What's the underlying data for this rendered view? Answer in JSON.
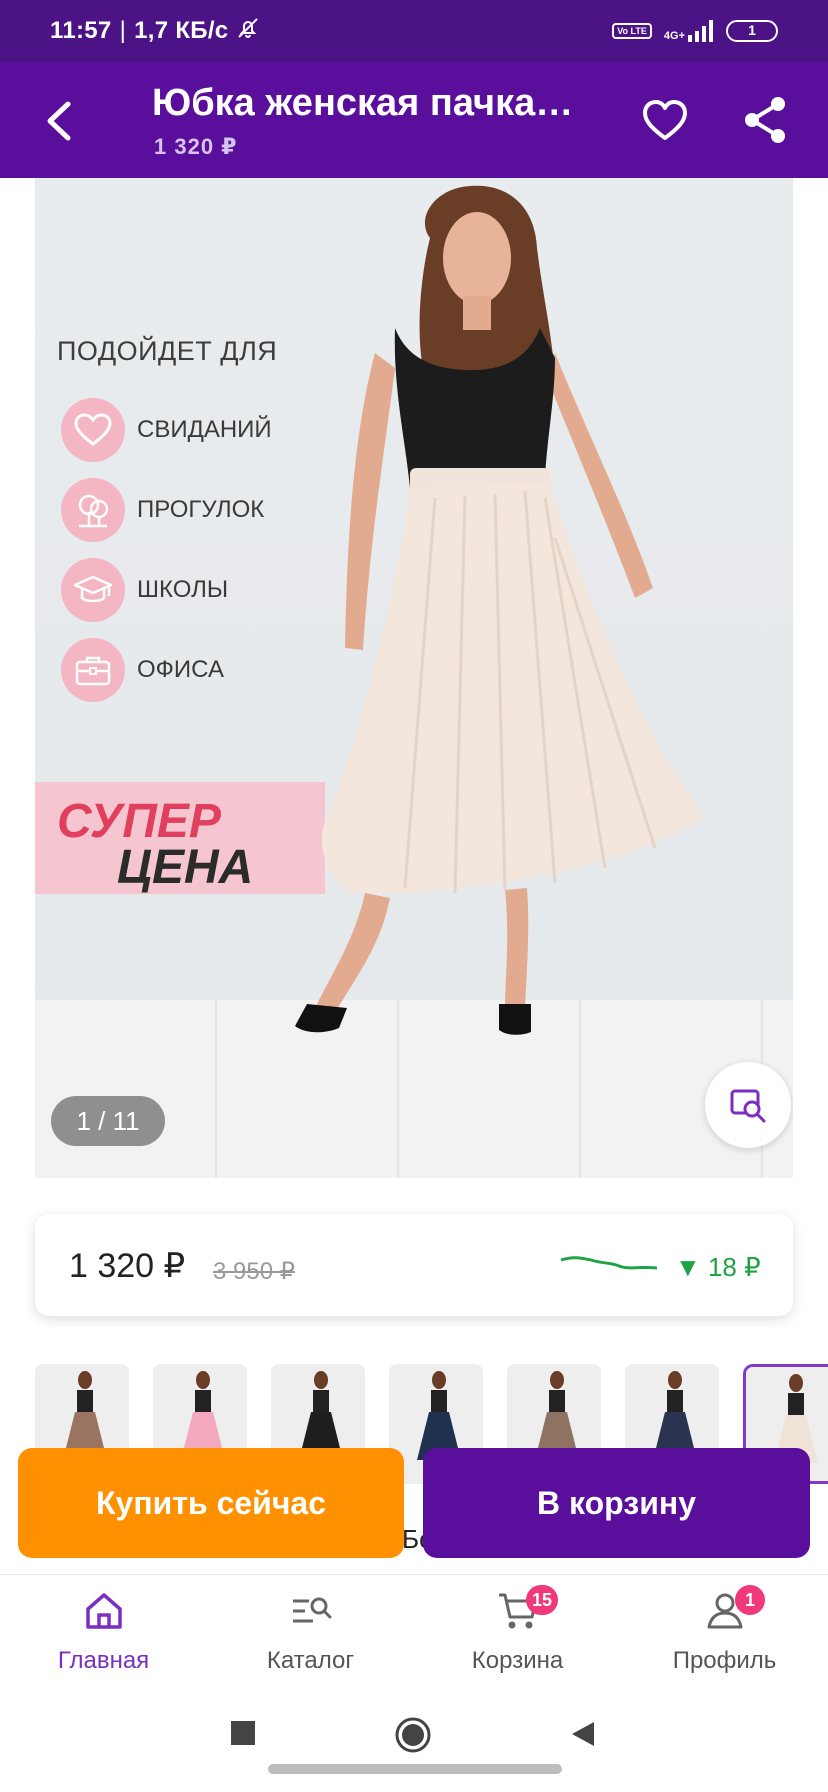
{
  "status_bar": {
    "time": "11:57",
    "separator": "|",
    "speed": "1,7 КБ/с",
    "volte": "Vo LTE",
    "network": "4G+",
    "battery": "1"
  },
  "header": {
    "title": "Юбка женская пачка…",
    "price": "1 320 ₽"
  },
  "product_image": {
    "suitable_title": "ПОДОЙДЕТ ДЛЯ",
    "suitable_items": [
      {
        "label": "СВИДАНИЙ",
        "icon": "heart-icon"
      },
      {
        "label": "ПРОГУЛОК",
        "icon": "tree-icon"
      },
      {
        "label": "ШКОЛЫ",
        "icon": "graduation-cap-icon"
      },
      {
        "label": "ОФИСА",
        "icon": "briefcase-icon"
      }
    ],
    "promo_line1": "СУПЕР",
    "promo_line2": "ЦЕНА",
    "counter": "1 / 11"
  },
  "price_card": {
    "current": "1 320 ₽",
    "old": "3 950 ₽",
    "delta": "▼ 18 ₽"
  },
  "thumbnails": [
    {
      "skirt_color": "#9b7461",
      "selected": false
    },
    {
      "skirt_color": "#f3a8bd",
      "selected": false
    },
    {
      "skirt_color": "#1e1e1e",
      "selected": false
    },
    {
      "skirt_color": "#20304f",
      "selected": false
    },
    {
      "skirt_color": "#8e7262",
      "selected": false
    },
    {
      "skirt_color": "#2a3350",
      "selected": false
    },
    {
      "skirt_color": "#efe3d8",
      "selected": true
    }
  ],
  "actions": {
    "buy_now": "Купить сейчас",
    "add_to_cart": "В корзину",
    "peek": "Бе"
  },
  "bottom_nav": [
    {
      "label": "Главная",
      "icon": "home-icon",
      "active": true,
      "badge": ""
    },
    {
      "label": "Каталог",
      "icon": "catalog-search-icon",
      "active": false,
      "badge": ""
    },
    {
      "label": "Корзина",
      "icon": "cart-icon",
      "active": false,
      "badge": "15"
    },
    {
      "label": "Профиль",
      "icon": "profile-icon",
      "active": false,
      "badge": "1"
    }
  ],
  "colors": {
    "header": "#5a0f9c",
    "status_bar": "#4b1385",
    "buy_button": "#ff9000",
    "cart_button": "#5a0f9c",
    "badge": "#f0387a",
    "price_down": "#1fa345",
    "active_nav": "#7b2fc0"
  }
}
